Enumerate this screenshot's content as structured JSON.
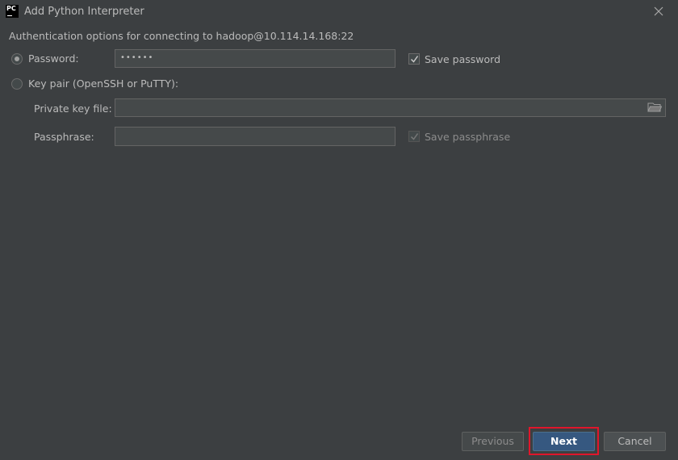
{
  "window": {
    "title": "Add Python Interpreter",
    "logo_text": "PC"
  },
  "subtitle": "Authentication options for connecting to hadoop@10.114.14.168:22",
  "auth": {
    "password_label": "Password:",
    "password_value": "••••••",
    "password_selected": true,
    "save_password_label": "Save password",
    "save_password_checked": true,
    "keypair_label": "Key pair (OpenSSH or PuTTY):",
    "keypair_selected": false,
    "private_key_label": "Private key file:",
    "private_key_value": "",
    "passphrase_label": "Passphrase:",
    "passphrase_value": "",
    "save_passphrase_label": "Save passphrase",
    "save_passphrase_checked": true
  },
  "footer": {
    "previous_label": "Previous",
    "next_label": "Next",
    "cancel_label": "Cancel"
  },
  "colors": {
    "background": "#3c3f41",
    "primary_button": "#365880",
    "highlight": "#e0162b"
  }
}
